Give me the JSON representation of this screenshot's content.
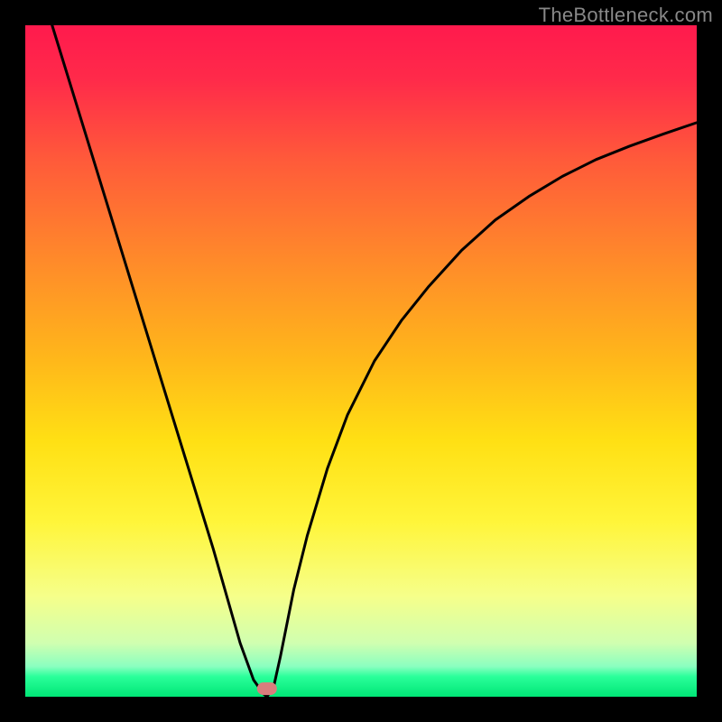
{
  "attribution": "TheBottleneck.com",
  "chart_data": {
    "type": "line",
    "title": "",
    "xlabel": "",
    "ylabel": "",
    "xlim": [
      0,
      100
    ],
    "ylim": [
      0,
      100
    ],
    "x_min_point": 36,
    "curve_left": {
      "x": [
        4,
        8,
        12,
        16,
        20,
        24,
        28,
        32,
        34,
        35.5,
        36
      ],
      "y": [
        100,
        87,
        74,
        61,
        48,
        35,
        22,
        8,
        2.5,
        0.4,
        0
      ]
    },
    "curve_right": {
      "x": [
        36,
        37,
        38,
        40,
        42,
        45,
        48,
        52,
        56,
        60,
        65,
        70,
        75,
        80,
        85,
        90,
        95,
        100
      ],
      "y": [
        0,
        1.5,
        6,
        16,
        24,
        34,
        42,
        50,
        56,
        61,
        66.5,
        71,
        74.5,
        77.5,
        80,
        82,
        83.8,
        85.5
      ]
    },
    "marker": {
      "x": 36,
      "y": 1.2,
      "color": "#d97d7d"
    },
    "background_gradient": {
      "top": "#ff1744",
      "upper_mid": "#ff8a00",
      "mid": "#ffea00",
      "lower": "#f4ff81",
      "bottom": "#00e676"
    }
  },
  "frame": {
    "border_width_fraction": 0.035
  }
}
